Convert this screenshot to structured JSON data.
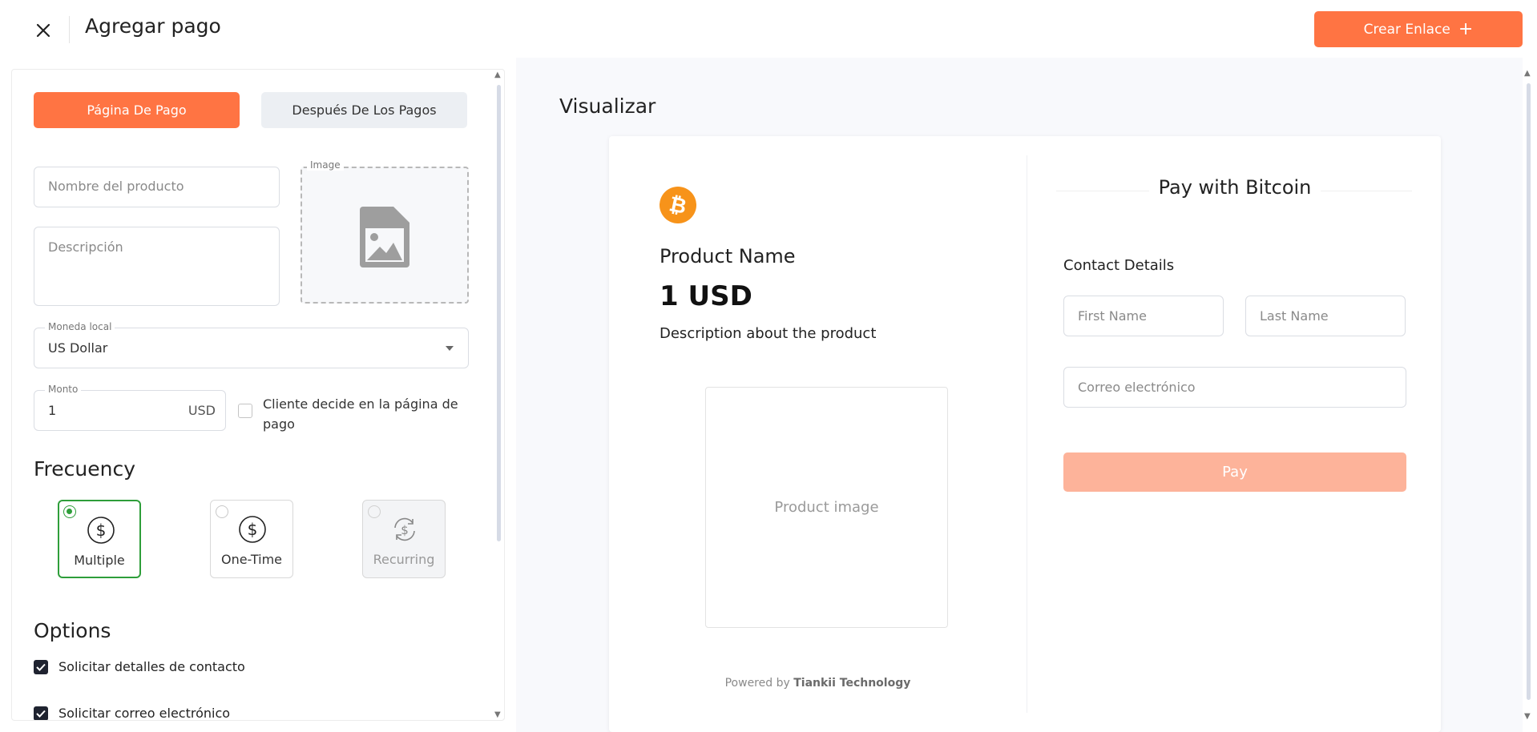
{
  "header": {
    "title": "Agregar pago",
    "create_button": "Crear Enlace",
    "create_icon": "+"
  },
  "tabs": [
    {
      "label": "Página De Pago",
      "active": true
    },
    {
      "label": "Después De Los Pagos",
      "active": false
    }
  ],
  "form": {
    "product_name_placeholder": "Nombre del producto",
    "description_placeholder": "Descripción",
    "image_label": "Image",
    "currency_label": "Moneda local",
    "currency_value": "US Dollar",
    "amount_label": "Monto",
    "amount_value": "1",
    "amount_currency": "USD",
    "customer_decides_label": "Cliente decide en la página de pago",
    "customer_decides_checked": false
  },
  "frequency": {
    "title": "Frecuency",
    "options": [
      {
        "label": "Multiple",
        "selected": true,
        "disabled": false,
        "icon": "dollar-circle-icon"
      },
      {
        "label": "One-Time",
        "selected": false,
        "disabled": false,
        "icon": "dollar-circle-icon"
      },
      {
        "label": "Recurring",
        "selected": false,
        "disabled": true,
        "icon": "recurring-dollar-icon"
      }
    ]
  },
  "options": {
    "title": "Options",
    "items": [
      {
        "label": "Solicitar detalles de contacto",
        "checked": true
      },
      {
        "label": "Solicitar correo electrónico",
        "checked": true
      }
    ]
  },
  "preview": {
    "title": "Visualizar",
    "product_name": "Product Name",
    "price": "1 USD",
    "description": "Description about the product",
    "product_image": "Product image",
    "powered_by_prefix": "Powered by",
    "powered_by_brand": "Tiankii Technology",
    "pay_title": "Pay with Bitcoin",
    "contact_details": "Contact Details",
    "first_name_placeholder": "First Name",
    "last_name_placeholder": "Last Name",
    "email_placeholder": "Correo electrónico",
    "pay_button": "Pay"
  },
  "colors": {
    "accent": "#ff7443",
    "accent_disabled": "#fdb39a",
    "selected_green": "#2e9e3a",
    "bitcoin_orange": "#f7931a"
  }
}
